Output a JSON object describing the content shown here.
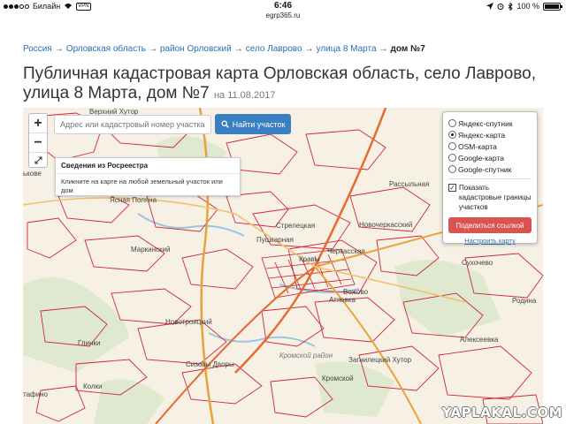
{
  "status_bar": {
    "carrier": "Билайн",
    "vpn": "VPN",
    "time": "6:46",
    "battery_text": "100 %",
    "battery_level": 1.0,
    "signal_bars": 3
  },
  "url": "egrp365.ru",
  "breadcrumb": {
    "items": [
      "Россия",
      "Орловская область",
      "район Орловский",
      "село Лаврово",
      "улица 8 Марта"
    ],
    "separator": "→",
    "current": "дом №7"
  },
  "page_title": "Публичная кадастровая карта Орловская область, село Лаврово, улица 8 Марта, дом №7",
  "page_date": "на 11.08.2017",
  "map": {
    "zoom_in": "+",
    "zoom_out": "−",
    "fullscreen_icon": "fullscreen-icon",
    "search_placeholder": "Адрес или кадастровый номер участка",
    "search_button": "Найти участок",
    "info_panel": {
      "title": "Сведения из Росреестра",
      "body": "Кликните на карте на любой земельный участок или дом"
    },
    "layers": {
      "options": [
        "Яндекс-спутник",
        "Яндекс-карта",
        "OSM-карта",
        "Google-карта",
        "Google-спутник"
      ],
      "selected": "Яндекс-карта",
      "checkbox_label": "Показать кадастровые границы участков",
      "checkbox_checked": true,
      "share_button": "Поделиться ссылкой",
      "setup_link": "Настроить карту"
    },
    "labels": {
      "l1": "Верхний Хутор",
      "l2": "Ясная Поляна",
      "l3": "Маркинский",
      "l4": "Новотроицкий",
      "l5": "Глинки",
      "l6": "Сизовы Дворы",
      "l7": "Колки",
      "l8": "Стрелецкая",
      "l9": "Пушкарная",
      "l10": "Кравы",
      "l11": "Черкасская",
      "l12": "Новочеркасский",
      "l13": "Рассыльная",
      "l14": "Вожово",
      "l15": "Атяевка",
      "l16": "Сухочево",
      "l17": "Родина",
      "l18": "Алексеевка",
      "l19": "Загнилецкий Хутор",
      "l20": "Кромской",
      "l21": "Кромской район",
      "l22": "тафино",
      "l23": "ькове"
    }
  },
  "watermark": "YAPLAKAL.COM",
  "colors": {
    "link": "#2a6fb5",
    "search_button": "#3a7fc1",
    "share_button": "#d9534f",
    "map_background": "#f6f1e4",
    "parcel_boundary": "#d0263a",
    "road": "#e8a23c"
  }
}
